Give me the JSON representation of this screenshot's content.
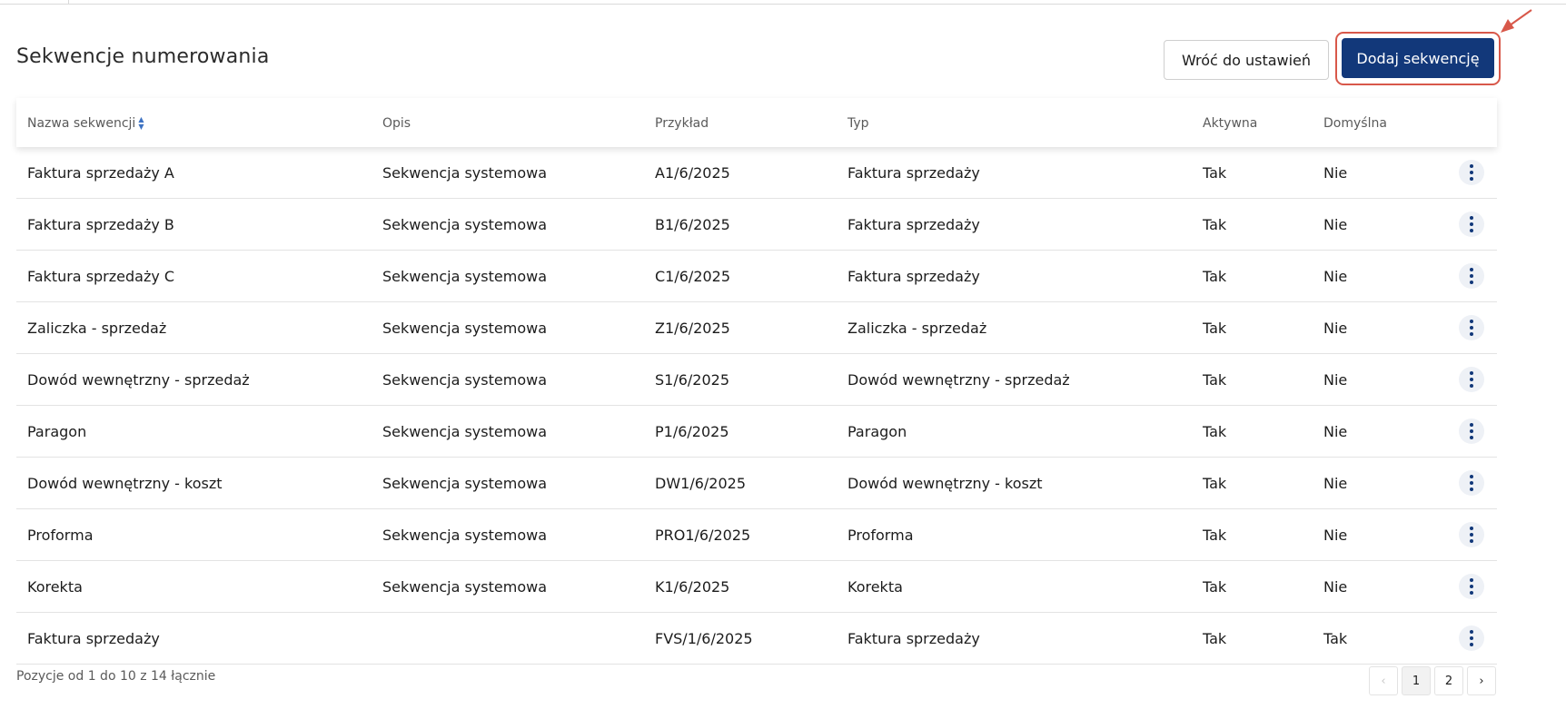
{
  "header": {
    "title": "Sekwencje numerowania",
    "back_label": "Wróć do ustawień",
    "add_label": "Dodaj sekwencję"
  },
  "table": {
    "columns": [
      "Nazwa sekwencji",
      "Opis",
      "Przykład",
      "Typ",
      "Aktywna",
      "Domyślna"
    ],
    "rows": [
      {
        "name": "Faktura sprzedaży A",
        "desc": "Sekwencja systemowa",
        "example": "A1/6/2025",
        "type": "Faktura sprzedaży",
        "active": "Tak",
        "default": "Nie"
      },
      {
        "name": "Faktura sprzedaży B",
        "desc": "Sekwencja systemowa",
        "example": "B1/6/2025",
        "type": "Faktura sprzedaży",
        "active": "Tak",
        "default": "Nie"
      },
      {
        "name": "Faktura sprzedaży C",
        "desc": "Sekwencja systemowa",
        "example": "C1/6/2025",
        "type": "Faktura sprzedaży",
        "active": "Tak",
        "default": "Nie"
      },
      {
        "name": "Zaliczka - sprzedaż",
        "desc": "Sekwencja systemowa",
        "example": "Z1/6/2025",
        "type": "Zaliczka - sprzedaż",
        "active": "Tak",
        "default": "Nie"
      },
      {
        "name": "Dowód wewnętrzny - sprzedaż",
        "desc": "Sekwencja systemowa",
        "example": "S1/6/2025",
        "type": "Dowód wewnętrzny - sprzedaż",
        "active": "Tak",
        "default": "Nie"
      },
      {
        "name": "Paragon",
        "desc": "Sekwencja systemowa",
        "example": "P1/6/2025",
        "type": "Paragon",
        "active": "Tak",
        "default": "Nie"
      },
      {
        "name": "Dowód wewnętrzny - koszt",
        "desc": "Sekwencja systemowa",
        "example": "DW1/6/2025",
        "type": "Dowód wewnętrzny - koszt",
        "active": "Tak",
        "default": "Nie"
      },
      {
        "name": "Proforma",
        "desc": "Sekwencja systemowa",
        "example": "PRO1/6/2025",
        "type": "Proforma",
        "active": "Tak",
        "default": "Nie"
      },
      {
        "name": "Korekta",
        "desc": "Sekwencja systemowa",
        "example": "K1/6/2025",
        "type": "Korekta",
        "active": "Tak",
        "default": "Nie"
      },
      {
        "name": "Faktura sprzedaży",
        "desc": "",
        "example": "FVS/1/6/2025",
        "type": "Faktura sprzedaży",
        "active": "Tak",
        "default": "Tak"
      }
    ]
  },
  "footer": {
    "info": "Pozycje od 1 do 10 z 14 łącznie",
    "prev_icon": "chevron-left-icon",
    "pages": [
      "1",
      "2"
    ],
    "current_page": "1",
    "next_icon": "chevron-right-icon"
  },
  "colors": {
    "primary": "#12387a",
    "highlight": "#d8584a",
    "sort_icon": "#3d72c2"
  },
  "icons": {
    "sort": "sort-icon",
    "row_menu": "kebab-menu-icon",
    "pointer": "pointer-arrow-icon"
  }
}
